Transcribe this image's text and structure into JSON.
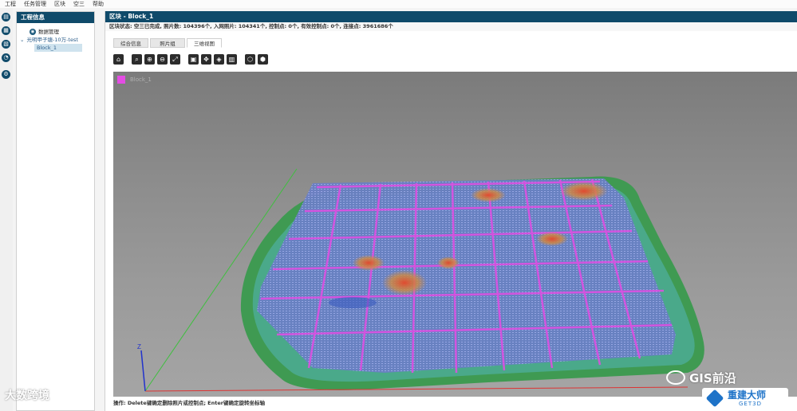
{
  "menu": [
    "工程",
    "任务管理",
    "区块",
    "空三",
    "帮助"
  ],
  "left_rail_icons": [
    "project-icon",
    "task-icon",
    "block-icon",
    "clock-icon",
    "settings-icon"
  ],
  "left_panel": {
    "title": "工程信息",
    "items": [
      {
        "label": "数据管理",
        "icon": "data-icon"
      },
      {
        "label": "光明甲子塘-10万-test",
        "expanded": true
      },
      {
        "label": "Block_1",
        "selected": true
      }
    ]
  },
  "main": {
    "title": "区块 - Block_1",
    "status": "区块状态: 空三已完成, 照片数: 104396个, 入网照片: 104341个, 控制点: 0个, 有效控制点: 0个, 连接点: 3961686个",
    "tabs": [
      "综合信息",
      "照片组",
      "三维视图"
    ],
    "active_tab": 2,
    "toolbar": [
      "⌂",
      "⌕",
      "⊕",
      "⊖",
      "⤢",
      "▣",
      "✥",
      "◈",
      "▥",
      "⬡",
      "⬢"
    ],
    "viewport": {
      "legend_label": "Block_1",
      "legend_color": "#e44ce4",
      "axis_z_label": "Z"
    },
    "hint": "操作: Delete键确定删除照片或控制点; Enter键确定旋转坐标轴"
  },
  "watermarks": {
    "left": "大数跨境",
    "right": "GIS前沿",
    "badge_cn": "重建大师",
    "badge_en": "GET3D"
  },
  "colors": {
    "header": "#0f4a6a",
    "magenta": "#e44ce4",
    "green": "#3f9a52",
    "blue_grid": "#7d86d8"
  }
}
